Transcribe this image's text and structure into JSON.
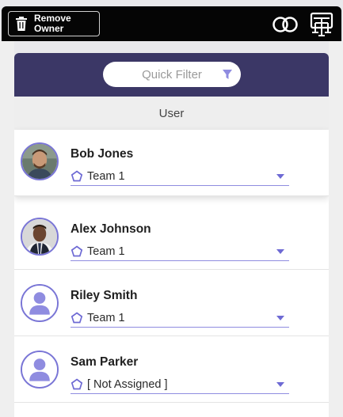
{
  "toolbar": {
    "remove_owner_label": "Remove Owner"
  },
  "filter": {
    "placeholder": "Quick Filter"
  },
  "table": {
    "column_header": "User"
  },
  "users": [
    {
      "name": "Bob Jones",
      "team": "Team 1",
      "avatar": "photo"
    },
    {
      "name": "Alex Johnson",
      "team": "Team 1",
      "avatar": "photo"
    },
    {
      "name": "Riley Smith",
      "team": "Team 1",
      "avatar": "placeholder"
    },
    {
      "name": "Sam Parker",
      "team": "[ Not Assigned ]",
      "avatar": "placeholder"
    }
  ],
  "colors": {
    "header_bg": "#3b3766",
    "accent": "#7a76d6",
    "topbar_bg": "#050505"
  },
  "icons": [
    "trash-icon",
    "toggle-icon",
    "org-chart-icon",
    "filter-icon",
    "team-icon",
    "caret-down-icon",
    "user-placeholder-icon"
  ]
}
